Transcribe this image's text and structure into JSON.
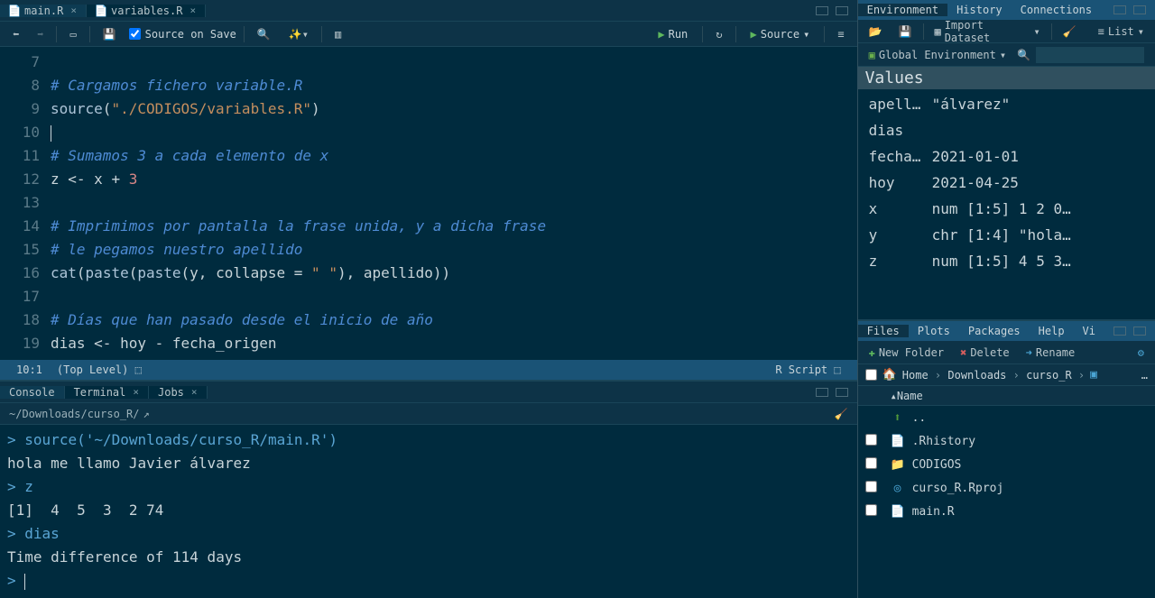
{
  "editor": {
    "tabs": [
      {
        "label": "main.R",
        "active": true
      },
      {
        "label": "variables.R",
        "active": false
      }
    ],
    "sourceOnSave": "Source on Save",
    "runLabel": "Run",
    "sourceLabel": "Source",
    "lines": [
      {
        "num": "7",
        "html": ""
      },
      {
        "num": "8",
        "html": "<span class='comment'># Cargamos fichero variable.R</span>"
      },
      {
        "num": "9",
        "html": "<span class='func'>source</span>(<span class='string'>\"./CODIGOS/variables.R\"</span>)"
      },
      {
        "num": "10",
        "html": "<span class='cursor'></span>"
      },
      {
        "num": "11",
        "html": "<span class='comment'># Sumamos 3 a cada elemento de x</span>"
      },
      {
        "num": "12",
        "html": "z <span class='op'>&lt;-</span> x <span class='op'>+</span> <span class='number'>3</span>"
      },
      {
        "num": "13",
        "html": ""
      },
      {
        "num": "14",
        "html": "<span class='comment'># Imprimimos por pantalla la frase unida, y a dicha frase</span>"
      },
      {
        "num": "15",
        "html": "<span class='comment'># le pegamos nuestro apellido</span>"
      },
      {
        "num": "16",
        "html": "<span class='func'>cat</span>(<span class='func'>paste</span>(<span class='func'>paste</span>(y, collapse <span class='op'>=</span> <span class='string'>\" \"</span>), apellido))"
      },
      {
        "num": "17",
        "html": ""
      },
      {
        "num": "18",
        "html": "<span class='comment'># Días que han pasado desde el inicio de año</span>"
      },
      {
        "num": "19",
        "html": "dias <span class='op'>&lt;-</span> hoy <span class='op'>-</span> fecha_origen"
      }
    ],
    "status": {
      "pos": "10:1",
      "scope": "(Top Level)",
      "lang": "R Script"
    }
  },
  "console": {
    "tabs": [
      "Console",
      "Terminal",
      "Jobs"
    ],
    "path": "~/Downloads/curso_R/",
    "lines": [
      "<span class='prompt'>&gt;</span> <span class='prompt'>source('~/Downloads/curso_R/main.R')</span>",
      "<span class='console-text'>hola me llamo Javier álvarez</span>",
      "<span class='prompt'>&gt;</span> <span class='prompt'>z</span>",
      "<span class='console-text'>[1]  4  5  3  2 74</span>",
      "<span class='prompt'>&gt;</span> <span class='prompt'>dias</span>",
      "<span class='console-text'>Time difference of 114 days</span>",
      "<span class='prompt'>&gt;</span> <span class='cursor'></span>"
    ]
  },
  "environment": {
    "tabs": [
      "Environment",
      "History",
      "Connections"
    ],
    "importLabel": "Import Dataset",
    "listLabel": "List",
    "scope": "Global Environment",
    "valuesHeader": "Values",
    "items": [
      {
        "name": "apell…",
        "value": "\"álvarez\""
      },
      {
        "name": "dias",
        "value": ""
      },
      {
        "name": "fecha…",
        "value": "2021-01-01"
      },
      {
        "name": "hoy",
        "value": "2021-04-25"
      },
      {
        "name": "x",
        "value": "num [1:5] 1 2 0…"
      },
      {
        "name": "y",
        "value": "chr [1:4] \"hola…"
      },
      {
        "name": "z",
        "value": "num [1:5] 4 5 3…"
      }
    ]
  },
  "files": {
    "tabs": [
      "Files",
      "Plots",
      "Packages",
      "Help",
      "Vi"
    ],
    "toolbar": {
      "newFolder": "New Folder",
      "delete": "Delete",
      "rename": "Rename"
    },
    "breadcrumbs": [
      "Home",
      "Downloads",
      "curso_R"
    ],
    "nameHeader": "Name",
    "items": [
      {
        "icon": "up",
        "name": ".."
      },
      {
        "icon": "file",
        "name": ".Rhistory"
      },
      {
        "icon": "folder",
        "name": "CODIGOS"
      },
      {
        "icon": "rproj",
        "name": "curso_R.Rproj"
      },
      {
        "icon": "rfile",
        "name": "main.R"
      }
    ]
  }
}
